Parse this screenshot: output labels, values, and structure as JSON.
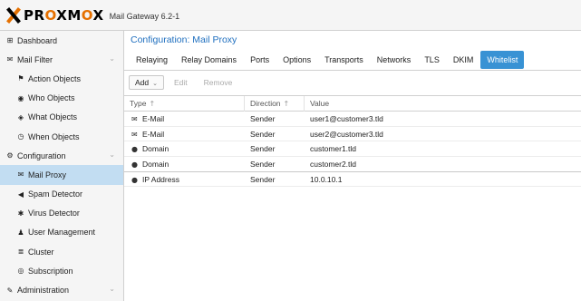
{
  "header": {
    "logo_prefix": "PR",
    "logo_o1": "O",
    "logo_mid": "XM",
    "logo_o2": "O",
    "logo_suffix": "X",
    "version": "Mail Gateway 6.2-1"
  },
  "sidebar": {
    "items": [
      {
        "label": "Dashboard",
        "icon": "dashboard-icon",
        "glyph": "⊞",
        "level": 0
      },
      {
        "label": "Mail Filter",
        "icon": "envelope-icon",
        "glyph": "✉",
        "level": 0,
        "expandable": true
      },
      {
        "label": "Action Objects",
        "icon": "flag-icon",
        "glyph": "⚑",
        "level": 1
      },
      {
        "label": "Who Objects",
        "icon": "user-circle-icon",
        "glyph": "◉",
        "level": 1
      },
      {
        "label": "What Objects",
        "icon": "cube-icon",
        "glyph": "◈",
        "level": 1
      },
      {
        "label": "When Objects",
        "icon": "clock-icon",
        "glyph": "◷",
        "level": 1
      },
      {
        "label": "Configuration",
        "icon": "cogs-icon",
        "glyph": "⚙",
        "level": 0,
        "expandable": true
      },
      {
        "label": "Mail Proxy",
        "icon": "envelope-o-icon",
        "glyph": "✉",
        "level": 1,
        "selected": true
      },
      {
        "label": "Spam Detector",
        "icon": "bullhorn-icon",
        "glyph": "◀",
        "level": 1
      },
      {
        "label": "Virus Detector",
        "icon": "bug-icon",
        "glyph": "✱",
        "level": 1
      },
      {
        "label": "User Management",
        "icon": "users-icon",
        "glyph": "♟",
        "level": 1
      },
      {
        "label": "Cluster",
        "icon": "server-icon",
        "glyph": "≣",
        "level": 1
      },
      {
        "label": "Subscription",
        "icon": "support-icon",
        "glyph": "◎",
        "level": 1
      },
      {
        "label": "Administration",
        "icon": "wrench-icon",
        "glyph": "✎",
        "level": 0,
        "expandable": true
      }
    ],
    "chevron": "⌄"
  },
  "main": {
    "title": "Configuration: Mail Proxy",
    "tabs": [
      {
        "label": "Relaying"
      },
      {
        "label": "Relay Domains"
      },
      {
        "label": "Ports"
      },
      {
        "label": "Options"
      },
      {
        "label": "Transports"
      },
      {
        "label": "Networks"
      },
      {
        "label": "TLS"
      },
      {
        "label": "DKIM"
      },
      {
        "label": "Whitelist",
        "active": true
      }
    ],
    "toolbar": {
      "add": "Add",
      "add_chevron": "⌄",
      "edit": "Edit",
      "remove": "Remove"
    },
    "columns": {
      "type": "Type",
      "direction": "Direction",
      "value": "Value",
      "sort_glyph": "↑"
    },
    "rows": [
      {
        "type": "E-Mail",
        "type_icon": "envelope-o-icon",
        "glyph": "✉",
        "direction": "Sender",
        "value": "user1@customer3.tld"
      },
      {
        "type": "E-Mail",
        "type_icon": "envelope-o-icon",
        "glyph": "✉",
        "direction": "Sender",
        "value": "user2@customer3.tld"
      },
      {
        "type": "Domain",
        "type_icon": "globe-icon",
        "glyph": "●",
        "direction": "Sender",
        "value": "customer1.tld"
      },
      {
        "type": "Domain",
        "type_icon": "globe-icon",
        "glyph": "●",
        "direction": "Sender",
        "value": "customer2.tld"
      },
      {
        "type": "IP Address",
        "type_icon": "globe-icon",
        "glyph": "●",
        "direction": "Sender",
        "value": "10.0.10.1"
      }
    ]
  },
  "colors": {
    "accent": "#3892d4",
    "title": "#1f6fbf",
    "selected": "#c2ddf2",
    "logo_orange": "#e57000"
  }
}
